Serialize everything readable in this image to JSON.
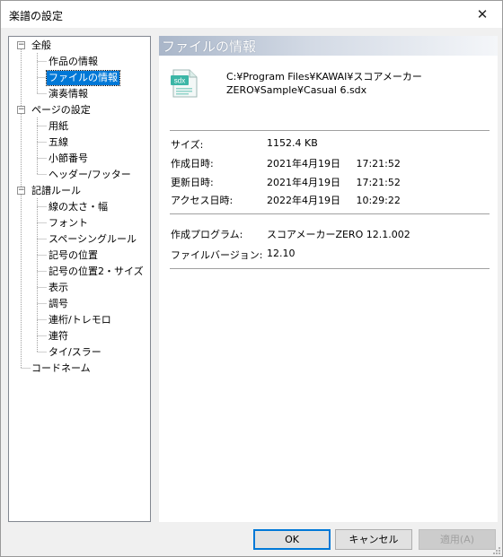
{
  "window": {
    "title": "楽譜の設定",
    "close_glyph": "✕"
  },
  "tree": {
    "groups": [
      {
        "label": "全般",
        "expander": "−",
        "children": [
          "作品の情報",
          "ファイルの情報",
          "演奏情報"
        ]
      },
      {
        "label": "ページの設定",
        "expander": "−",
        "children": [
          "用紙",
          "五線",
          "小節番号",
          "ヘッダー/フッター"
        ]
      },
      {
        "label": "記譜ルール",
        "expander": "−",
        "children": [
          "線の太さ・幅",
          "フォント",
          "スペーシングルール",
          "記号の位置",
          "記号の位置2・サイズ",
          "表示",
          "調号",
          "連桁/トレモロ",
          "連符",
          "タイ/スラー"
        ]
      }
    ],
    "last_item": "コードネーム",
    "selected": "ファイルの情報"
  },
  "panel": {
    "header": "ファイルの情報",
    "file_icon": "sdx-file-icon",
    "file_icon_text": "sdx",
    "path_line1": "C:¥Program Files¥KAWAI¥スコアメーカー",
    "path_line2": "ZERO¥Sample¥Casual 6.sdx",
    "properties": [
      {
        "label": "サイズ:",
        "value": "1152.4 KB"
      },
      {
        "label": "作成日時:",
        "value": "2021年4月19日     17:21:52"
      },
      {
        "label": "更新日時:",
        "value": "2021年4月19日     17:21:52"
      },
      {
        "label": "アクセス日時:",
        "value": "2022年4月19日     10:29:22"
      }
    ],
    "program": [
      {
        "label": "作成プログラム:",
        "value": "スコアメーカーZERO 12.1.002"
      },
      {
        "label": "ファイルバージョン:",
        "value": "12.10"
      }
    ]
  },
  "buttons": {
    "ok": "OK",
    "cancel": "キャンセル",
    "apply": "適用(A)"
  },
  "colors": {
    "selection": "#0078d7",
    "header_gradient_start": "#a9b6c9",
    "icon_accent": "#3bb6a6"
  }
}
